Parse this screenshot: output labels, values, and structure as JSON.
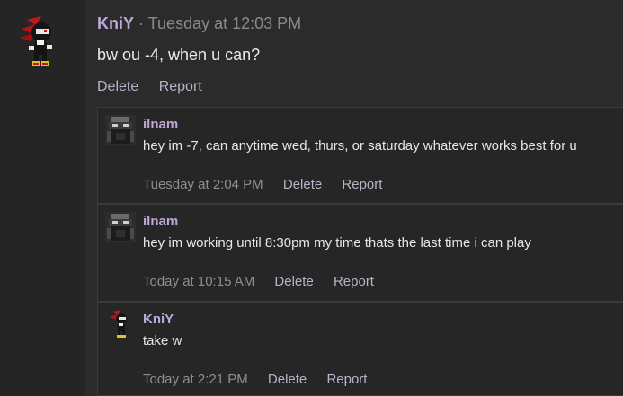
{
  "post": {
    "username": "KniY",
    "separator": "·",
    "timestamp": "Tuesday at 12:03 PM",
    "body": "bw ou -4, when u can?",
    "actions": {
      "delete": "Delete",
      "report": "Report"
    }
  },
  "replies": [
    {
      "username": "ilnam",
      "text": "hey im -7, can anytime wed, thurs, or saturday whatever works best for u",
      "timestamp": "Tuesday at 2:04 PM",
      "delete": "Delete",
      "report": "Report",
      "avatar_icon": "masked-figure-avatar"
    },
    {
      "username": "ilnam",
      "text": "hey im working until 8:30pm my time thats the last time i can play",
      "timestamp": "Today at 10:15 AM",
      "delete": "Delete",
      "report": "Report",
      "avatar_icon": "masked-figure-avatar"
    },
    {
      "username": "KniY",
      "text": "take w",
      "timestamp": "Today at 2:21 PM",
      "delete": "Delete",
      "report": "Report",
      "avatar_icon": "shadow-hedgehog-avatar"
    }
  ],
  "colors": {
    "username": "#b9a8d8",
    "timestamp": "#8a8a8a",
    "link": "#b5b5c8",
    "background": "#2b2b2b",
    "reply_background": "#262626"
  }
}
